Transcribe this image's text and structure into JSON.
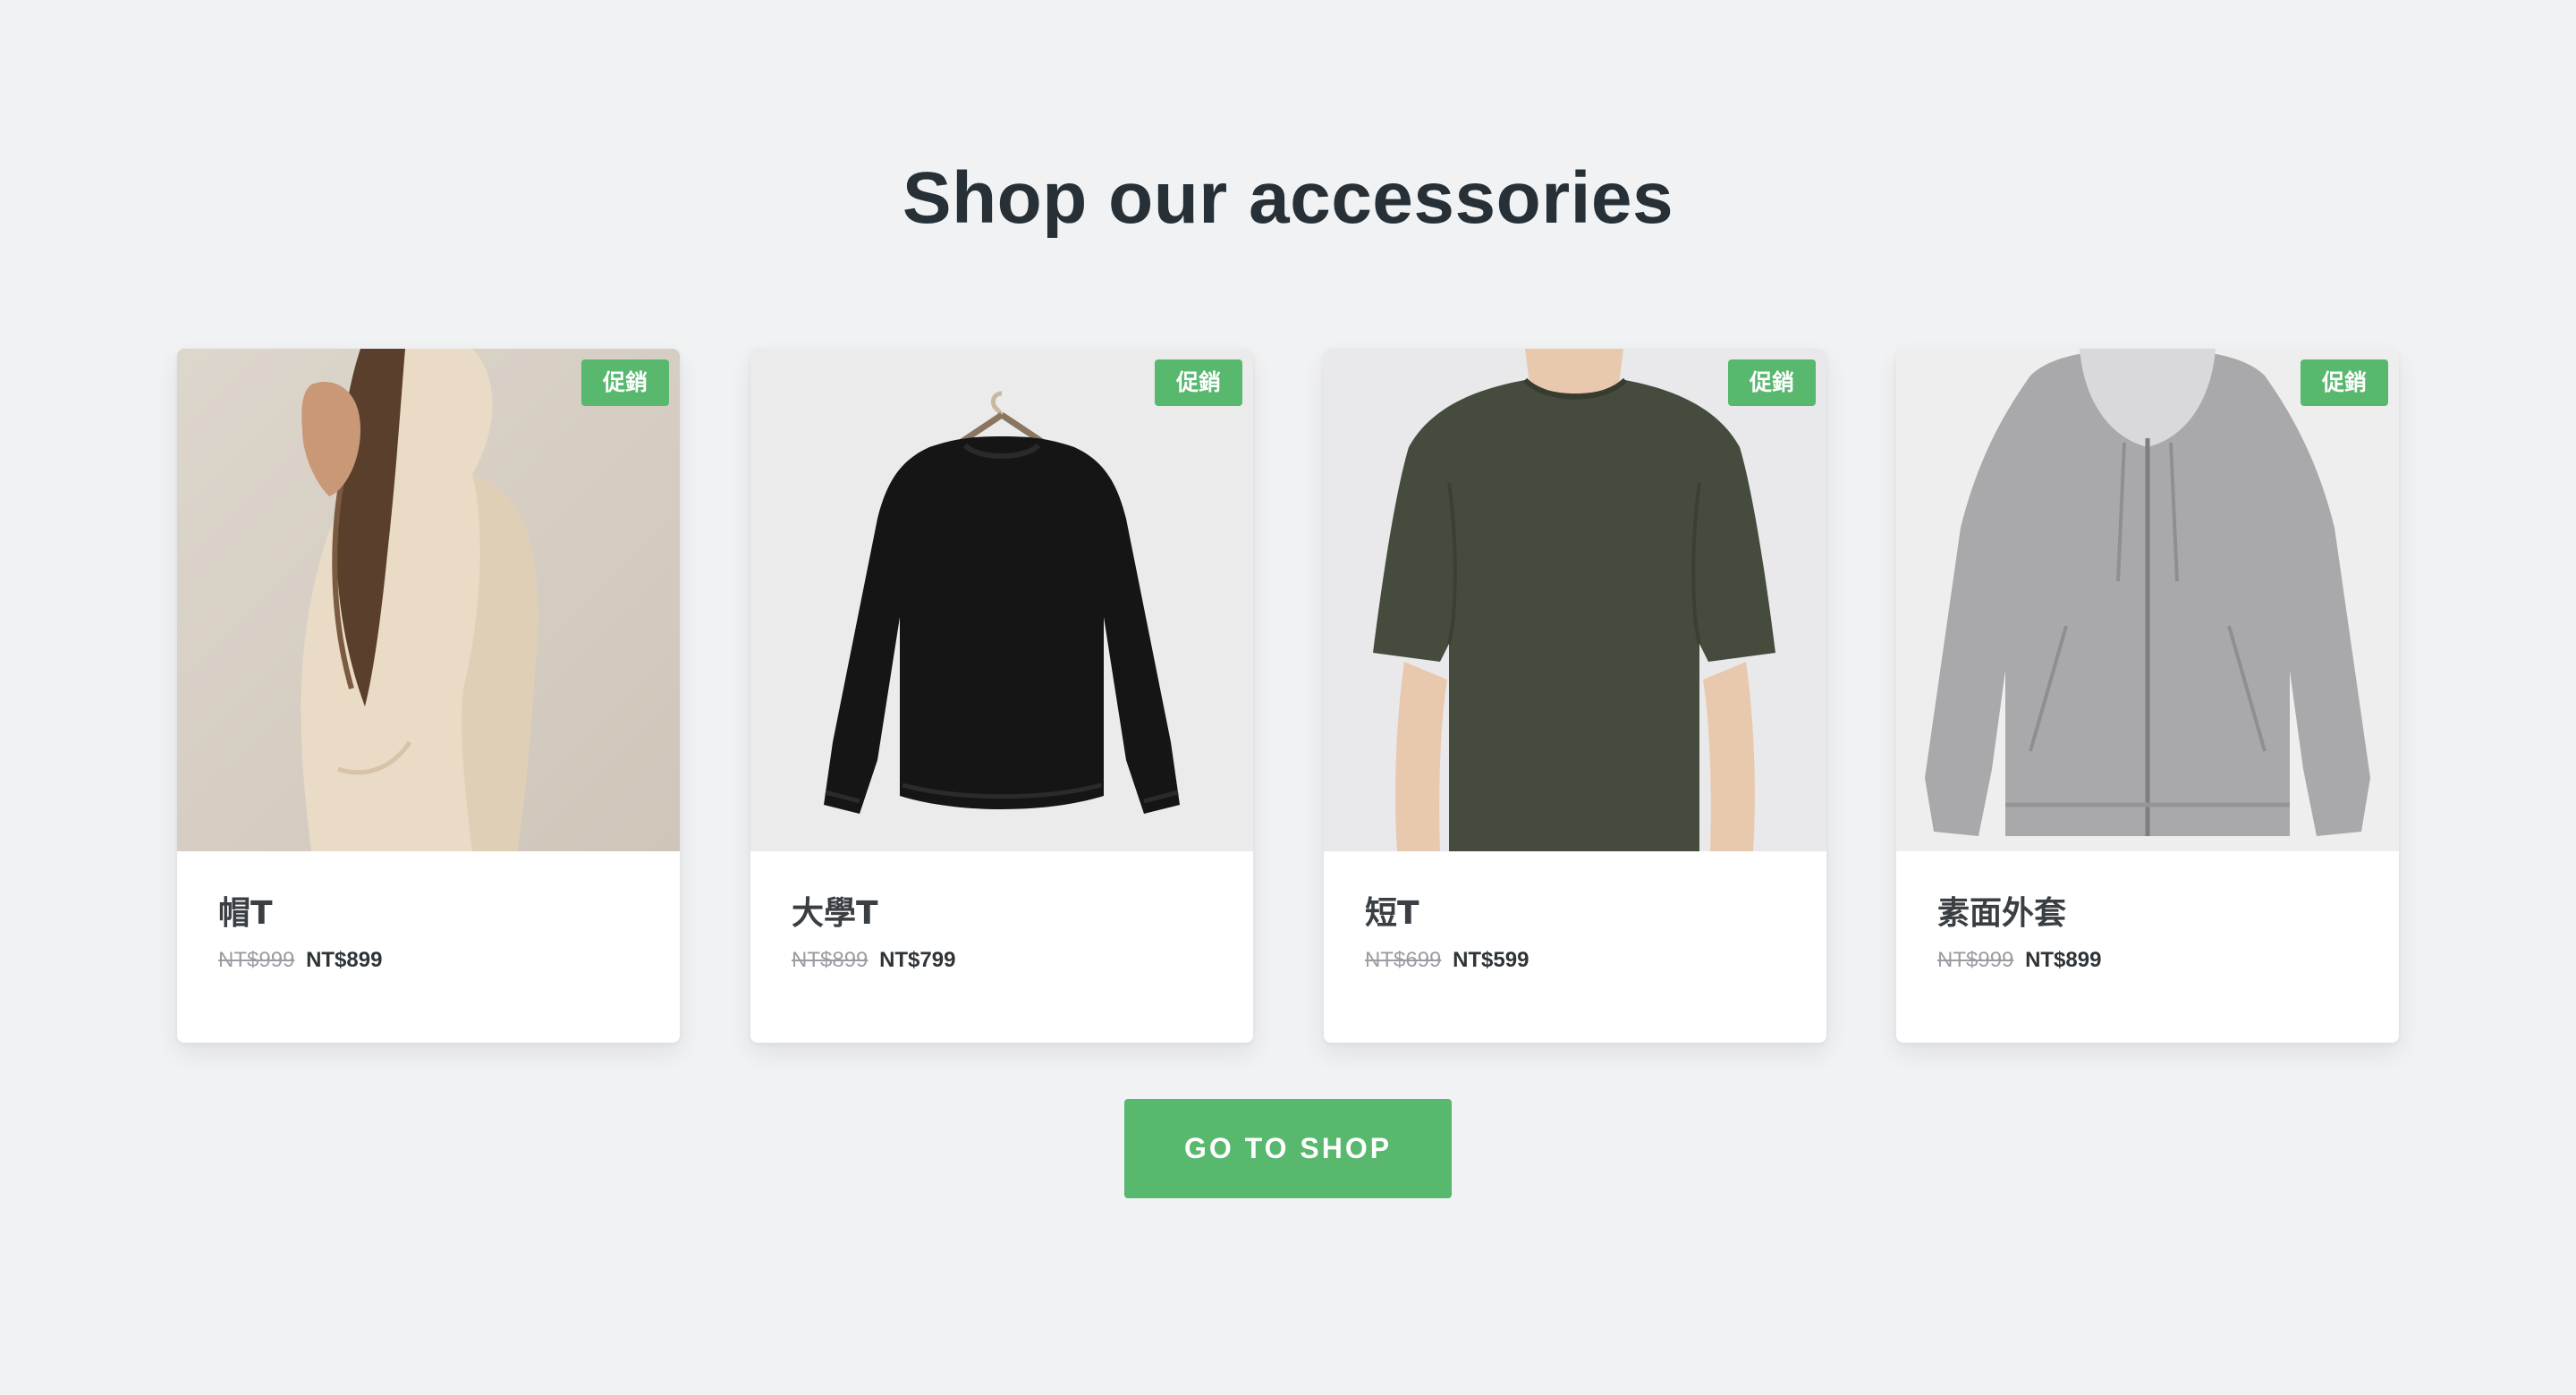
{
  "section": {
    "title": "Shop our accessories",
    "cta_label": "GO TO SHOP"
  },
  "colors": {
    "background": "#f1f2f4",
    "accent": "#57b86e",
    "heading": "#263036"
  },
  "products": [
    {
      "badge": "促銷",
      "name": "帽T",
      "old_price": "NT$999",
      "price": "NT$899",
      "image": "beige-hoodie-model-photo"
    },
    {
      "badge": "促銷",
      "name": "大學T",
      "old_price": "NT$899",
      "price": "NT$799",
      "image": "black-sweatshirt-on-hanger-photo"
    },
    {
      "badge": "促銷",
      "name": "短T",
      "old_price": "NT$699",
      "price": "NT$599",
      "image": "olive-tshirt-model-photo"
    },
    {
      "badge": "促銷",
      "name": "素面外套",
      "old_price": "NT$999",
      "price": "NT$899",
      "image": "grey-zip-hoodie-photo"
    }
  ]
}
